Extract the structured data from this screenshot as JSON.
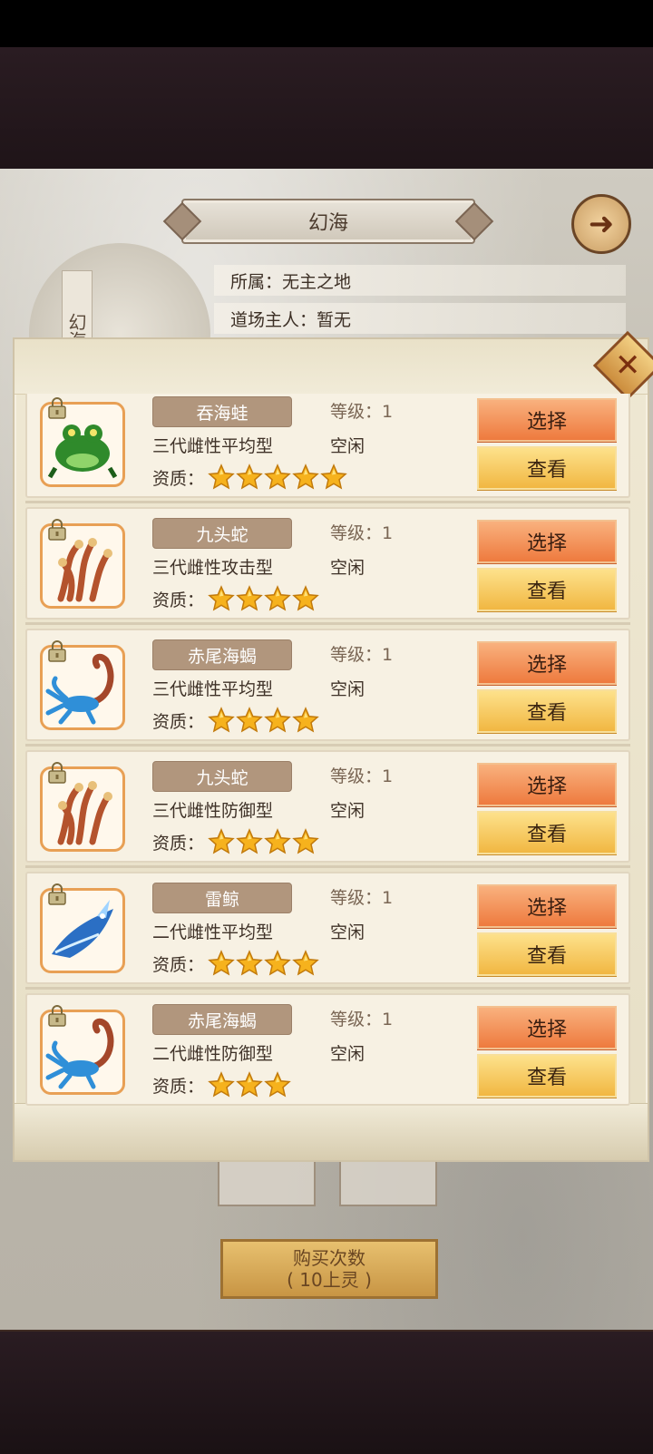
{
  "header": {
    "title": "幻海"
  },
  "portrait_label": "幻海",
  "info": {
    "owner_faction": "所属：无主之地",
    "dojo_owner": "道场主人：暂无"
  },
  "buy_button": {
    "line1": "购买次数",
    "line2": "( 10上灵 )"
  },
  "labels": {
    "quality": "资质：",
    "select": "选择",
    "view": "查看"
  },
  "pets": [
    {
      "name": "吞海蛙",
      "trait": "三代雌性平均型",
      "level": "等级：1",
      "status": "空闲",
      "stars": 5,
      "creature": "toad",
      "color": "#2f8a2b"
    },
    {
      "name": "九头蛇",
      "trait": "三代雌性攻击型",
      "level": "等级：1",
      "status": "空闲",
      "stars": 4,
      "creature": "hydra",
      "color": "#b4532d"
    },
    {
      "name": "赤尾海蝎",
      "trait": "三代雌性平均型",
      "level": "等级：1",
      "status": "空闲",
      "stars": 4,
      "creature": "scorpion",
      "color": "#2f8fd8"
    },
    {
      "name": "九头蛇",
      "trait": "三代雌性防御型",
      "level": "等级：1",
      "status": "空闲",
      "stars": 4,
      "creature": "hydra",
      "color": "#b4532d"
    },
    {
      "name": "雷鲸",
      "trait": "二代雌性平均型",
      "level": "等级：1",
      "status": "空闲",
      "stars": 4,
      "creature": "whale",
      "color": "#2b6fc4"
    },
    {
      "name": "赤尾海蝎",
      "trait": "二代雌性防御型",
      "level": "等级：1",
      "status": "空闲",
      "stars": 3,
      "creature": "scorpion",
      "color": "#2f8fd8"
    }
  ]
}
